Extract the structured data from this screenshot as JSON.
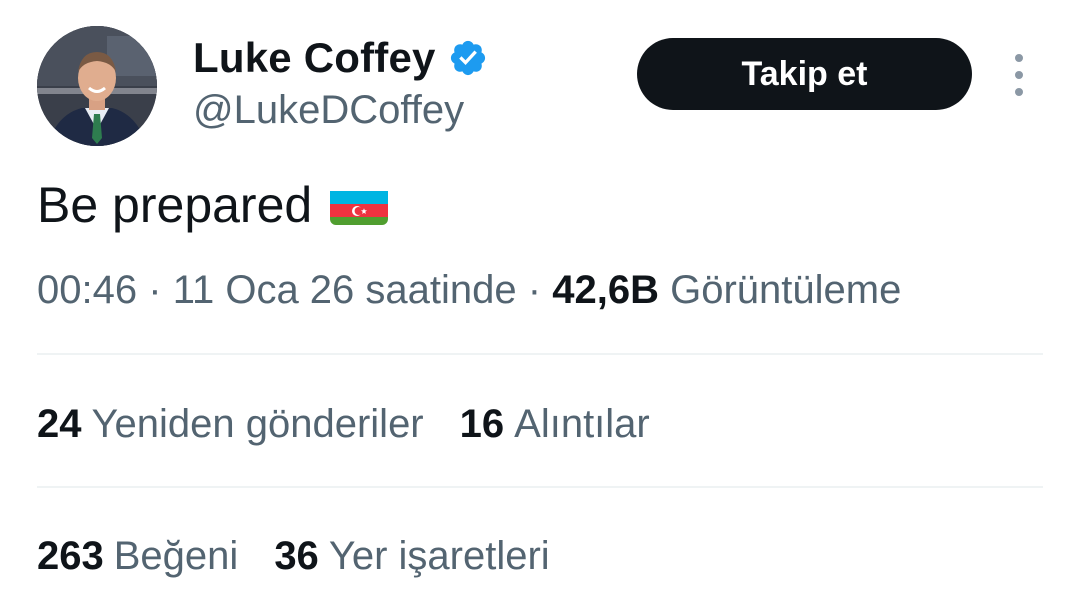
{
  "author": {
    "display_name": "Luke Coffey",
    "handle": "@LukeDCoffey"
  },
  "follow_button_label": "Takip et",
  "tweet": {
    "text": "Be prepared"
  },
  "meta": {
    "time": "00:46",
    "separator": "·",
    "date": "11 Oca 26 saatinde",
    "views_count": "42,6B",
    "views_label": "Görüntüleme"
  },
  "stats": {
    "retweets_count": "24",
    "retweets_label": "Yeniden gönderiler",
    "quotes_count": "16",
    "quotes_label": "Alıntılar",
    "likes_count": "263",
    "likes_label": "Beğeni",
    "bookmarks_count": "36",
    "bookmarks_label": "Yer işaretleri"
  },
  "icons": {
    "verified": "verified-badge-icon",
    "flag": "azerbaijan-flag-icon",
    "more": "more-options-icon"
  },
  "colors": {
    "verified_blue": "#1d9bf0",
    "follow_bg": "#0f1419",
    "secondary_text": "#536471",
    "divider": "#eff3f4"
  }
}
